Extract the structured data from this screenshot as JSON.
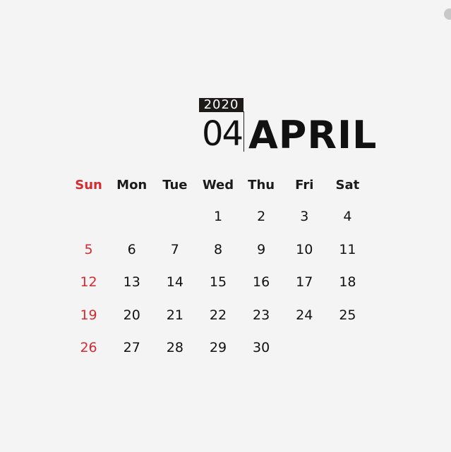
{
  "calendar": {
    "year": "2020",
    "month_number": "04",
    "month_name": "APRIL",
    "weekdays": [
      "Sun",
      "Mon",
      "Tue",
      "Wed",
      "Thu",
      "Fri",
      "Sat"
    ],
    "weeks": [
      [
        "",
        "",
        "",
        "1",
        "2",
        "3",
        "4"
      ],
      [
        "5",
        "6",
        "7",
        "8",
        "9",
        "10",
        "11"
      ],
      [
        "12",
        "13",
        "14",
        "15",
        "16",
        "17",
        "18"
      ],
      [
        "19",
        "20",
        "21",
        "22",
        "23",
        "24",
        "25"
      ],
      [
        "26",
        "27",
        "28",
        "29",
        "30",
        "",
        ""
      ]
    ],
    "colors": {
      "background": "#f4f4f4",
      "sunday": "#d52a32",
      "text": "#111111",
      "year_badge": "#1f1a1a"
    }
  }
}
